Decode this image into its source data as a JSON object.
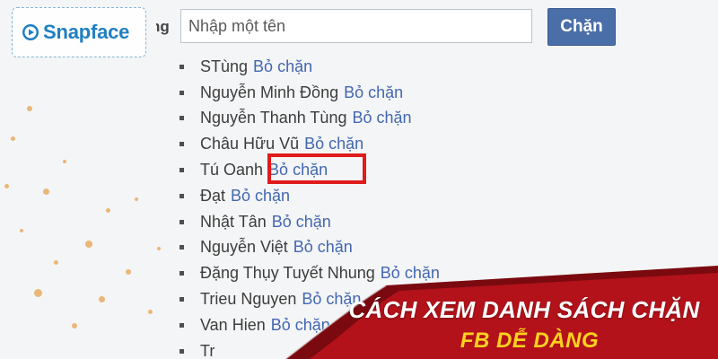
{
  "logo": {
    "text": "Snapface",
    "icon": "play-bubble-icon"
  },
  "block_form": {
    "label_fragment": "ng",
    "input_placeholder": "Nhập một tên",
    "input_value": "",
    "button_label": "Chặn"
  },
  "blocked_list": {
    "items": [
      {
        "name": "STùng",
        "action": "Bỏ chặn"
      },
      {
        "name": "Nguyễn Minh Đồng",
        "action": "Bỏ chặn"
      },
      {
        "name": "Nguyễn Thanh Tùng",
        "action": "Bỏ chặn"
      },
      {
        "name": "Châu Hữu Vũ",
        "action": "Bỏ chặn"
      },
      {
        "name": "Tú Oanh",
        "action": "Bỏ chặn"
      },
      {
        "name": "Đạt",
        "action": "Bỏ chặn"
      },
      {
        "name": "Nhật Tân",
        "action": "Bỏ chặn"
      },
      {
        "name": "Nguyễn Việt",
        "action": "Bỏ chặn"
      },
      {
        "name": "Đặng Thụy Tuyết Nhung",
        "action": "Bỏ chặn"
      },
      {
        "name": "Trieu Nguyen",
        "action": "Bỏ chặn"
      },
      {
        "name": "Van Hien",
        "action": "Bỏ chặn"
      },
      {
        "name": "Tr",
        "action": ""
      }
    ]
  },
  "banner": {
    "line1": "CÁCH XEM DANH SÁCH CHẶN",
    "line2": "FB DỄ DÀNG"
  },
  "colors": {
    "link": "#4267b2",
    "button": "#4a6ea8",
    "highlight": "#e01b1b",
    "banner_red": "#b3121a",
    "banner_text_accent": "#ffd21f"
  }
}
